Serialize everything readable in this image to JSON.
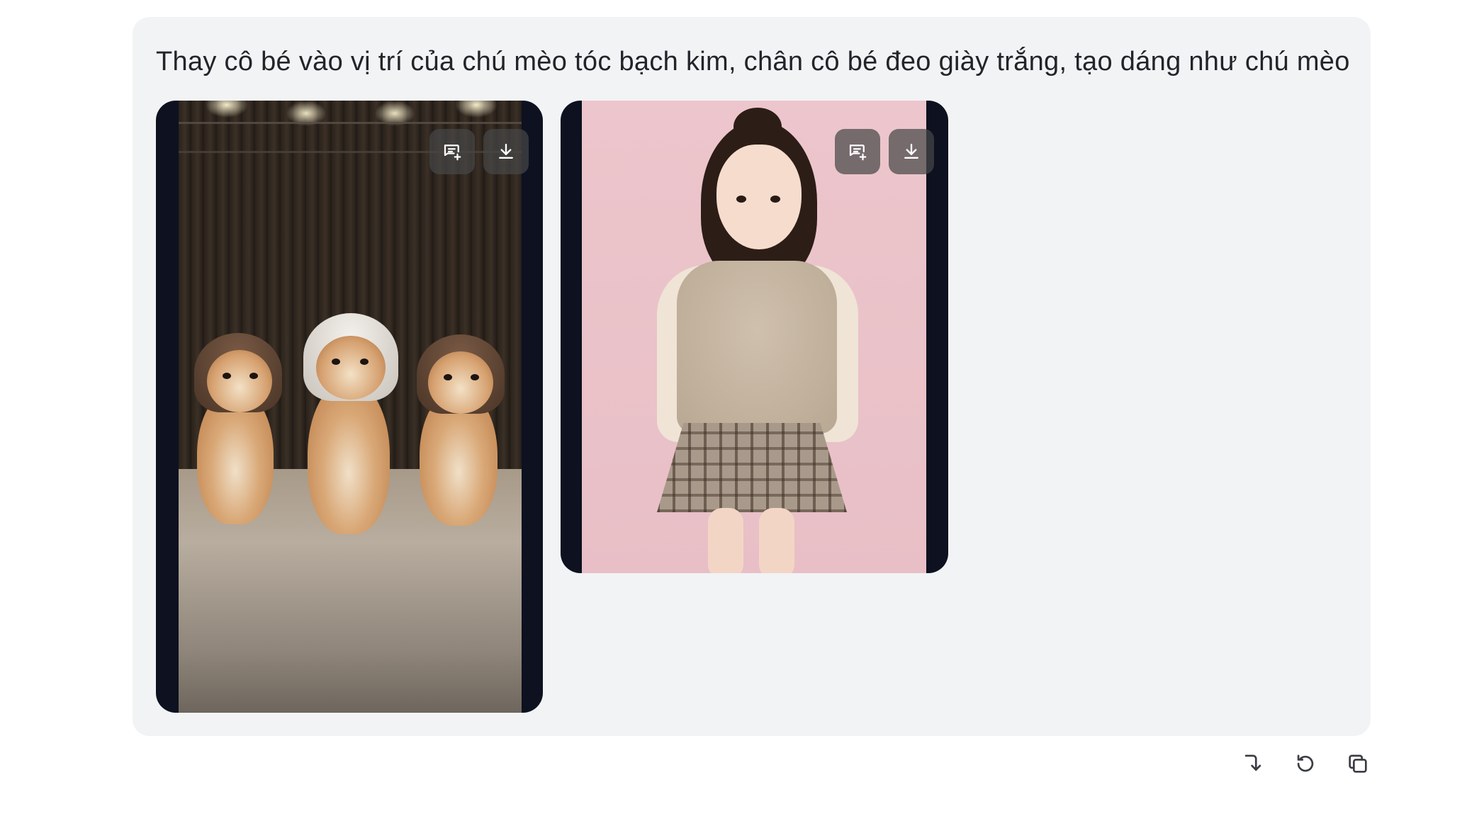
{
  "message": {
    "prompt_text": "Thay cô bé vào vị trí của chú mèo tóc bạch kim, chân cô bé đeo giày trắng, tạo dáng như chú mèo"
  },
  "attachments": [
    {
      "subject": "three cats in wigs on stage",
      "actions": [
        "comment-add-icon",
        "download-icon"
      ]
    },
    {
      "subject": "young girl in fur vest and plaid skirt",
      "actions": [
        "comment-add-icon",
        "download-icon"
      ]
    }
  ],
  "toolbar": {
    "icons": [
      "branch-down-icon",
      "regenerate-icon",
      "copy-icon"
    ]
  },
  "colors": {
    "bubble_bg": "#f2f3f5",
    "text": "#222429",
    "card_frame": "#0d1120",
    "button_overlay": "#464646",
    "toolbar_icon": "#3a3d44"
  }
}
